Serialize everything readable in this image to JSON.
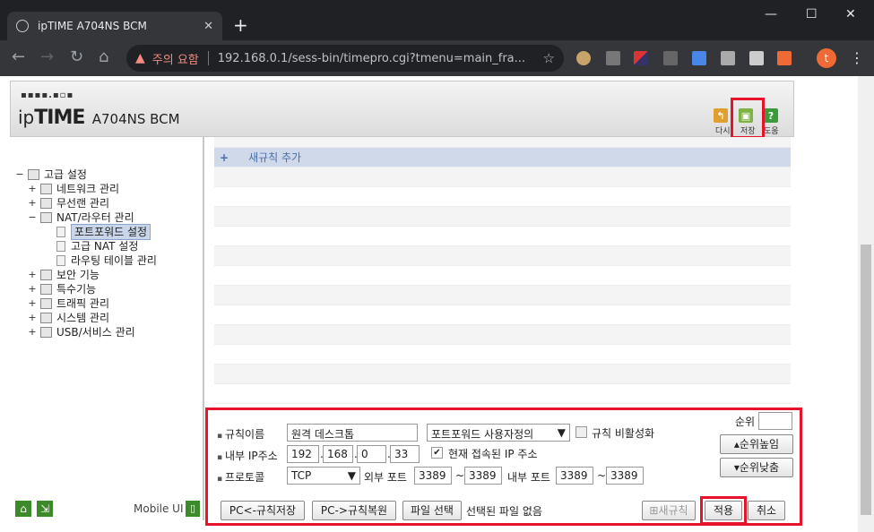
{
  "browser": {
    "tab_title": "ipTIME A704NS BCM",
    "security_warning": "주의 요함",
    "url": "192.168.0.1/sess-bin/timepro.cgi?tmenu=main_fra...",
    "profile_initial": "t"
  },
  "header": {
    "logo_dots": "▪▪▪▪.▪▫▪",
    "brand_ip": "ip",
    "brand_time": "TIME",
    "model": "A704NS BCM",
    "buttons": {
      "restart_label": "다시",
      "save_label": "저장",
      "help_label": "도움"
    }
  },
  "sidebar": {
    "tree": [
      {
        "label": "고급 설정",
        "toggle": "−",
        "level": 0
      },
      {
        "label": "네트워크 관리",
        "toggle": "+",
        "level": 1
      },
      {
        "label": "무선랜 관리",
        "toggle": "+",
        "level": 1
      },
      {
        "label": "NAT/라우터 관리",
        "toggle": "−",
        "level": 1
      },
      {
        "label": "포트포워드 설정",
        "toggle": "",
        "level": 2,
        "selected": true
      },
      {
        "label": "고급 NAT 설정",
        "toggle": "",
        "level": 2
      },
      {
        "label": "라우팅 테이블 관리",
        "toggle": "",
        "level": 2
      },
      {
        "label": "보안 기능",
        "toggle": "+",
        "level": 1
      },
      {
        "label": "특수기능",
        "toggle": "+",
        "level": 1
      },
      {
        "label": "트래픽 관리",
        "toggle": "+",
        "level": 1
      },
      {
        "label": "시스템 관리",
        "toggle": "+",
        "level": 1
      },
      {
        "label": "USB/서비스 관리",
        "toggle": "+",
        "level": 1
      }
    ],
    "mobile_ui": "Mobile UI"
  },
  "list": {
    "add_rule": "새규칙 추가"
  },
  "form": {
    "rule_name_label": "규칙이름",
    "rule_name_value": "원격 데스크톱",
    "rule_type_value": "포트포워드 사용자정의",
    "disable_rule_label": "규칙 비활성화",
    "priority_label": "순위",
    "priority_up": "▴순위높임",
    "priority_down": "▾순위낮춤",
    "internal_ip_label": "내부 IP주소",
    "ip": [
      "192",
      "168",
      "0",
      "33"
    ],
    "current_ip_label": "현재 접속된 IP 주소",
    "protocol_label": "프로토콜",
    "protocol_value": "TCP",
    "external_port_label": "외부 포트",
    "ext_port_start": "3389",
    "ext_port_end": "3389",
    "internal_port_label": "내부 포트",
    "int_port_start": "3389",
    "int_port_end": "3389",
    "tilde": "~",
    "pc_save_rules": "PC<-규칙저장",
    "pc_restore_rules": "PC->규칙복원",
    "file_select": "파일 선택",
    "no_file": "선택된 파일 없음",
    "new_rule": "새규칙",
    "apply": "적용",
    "cancel": "취소"
  }
}
